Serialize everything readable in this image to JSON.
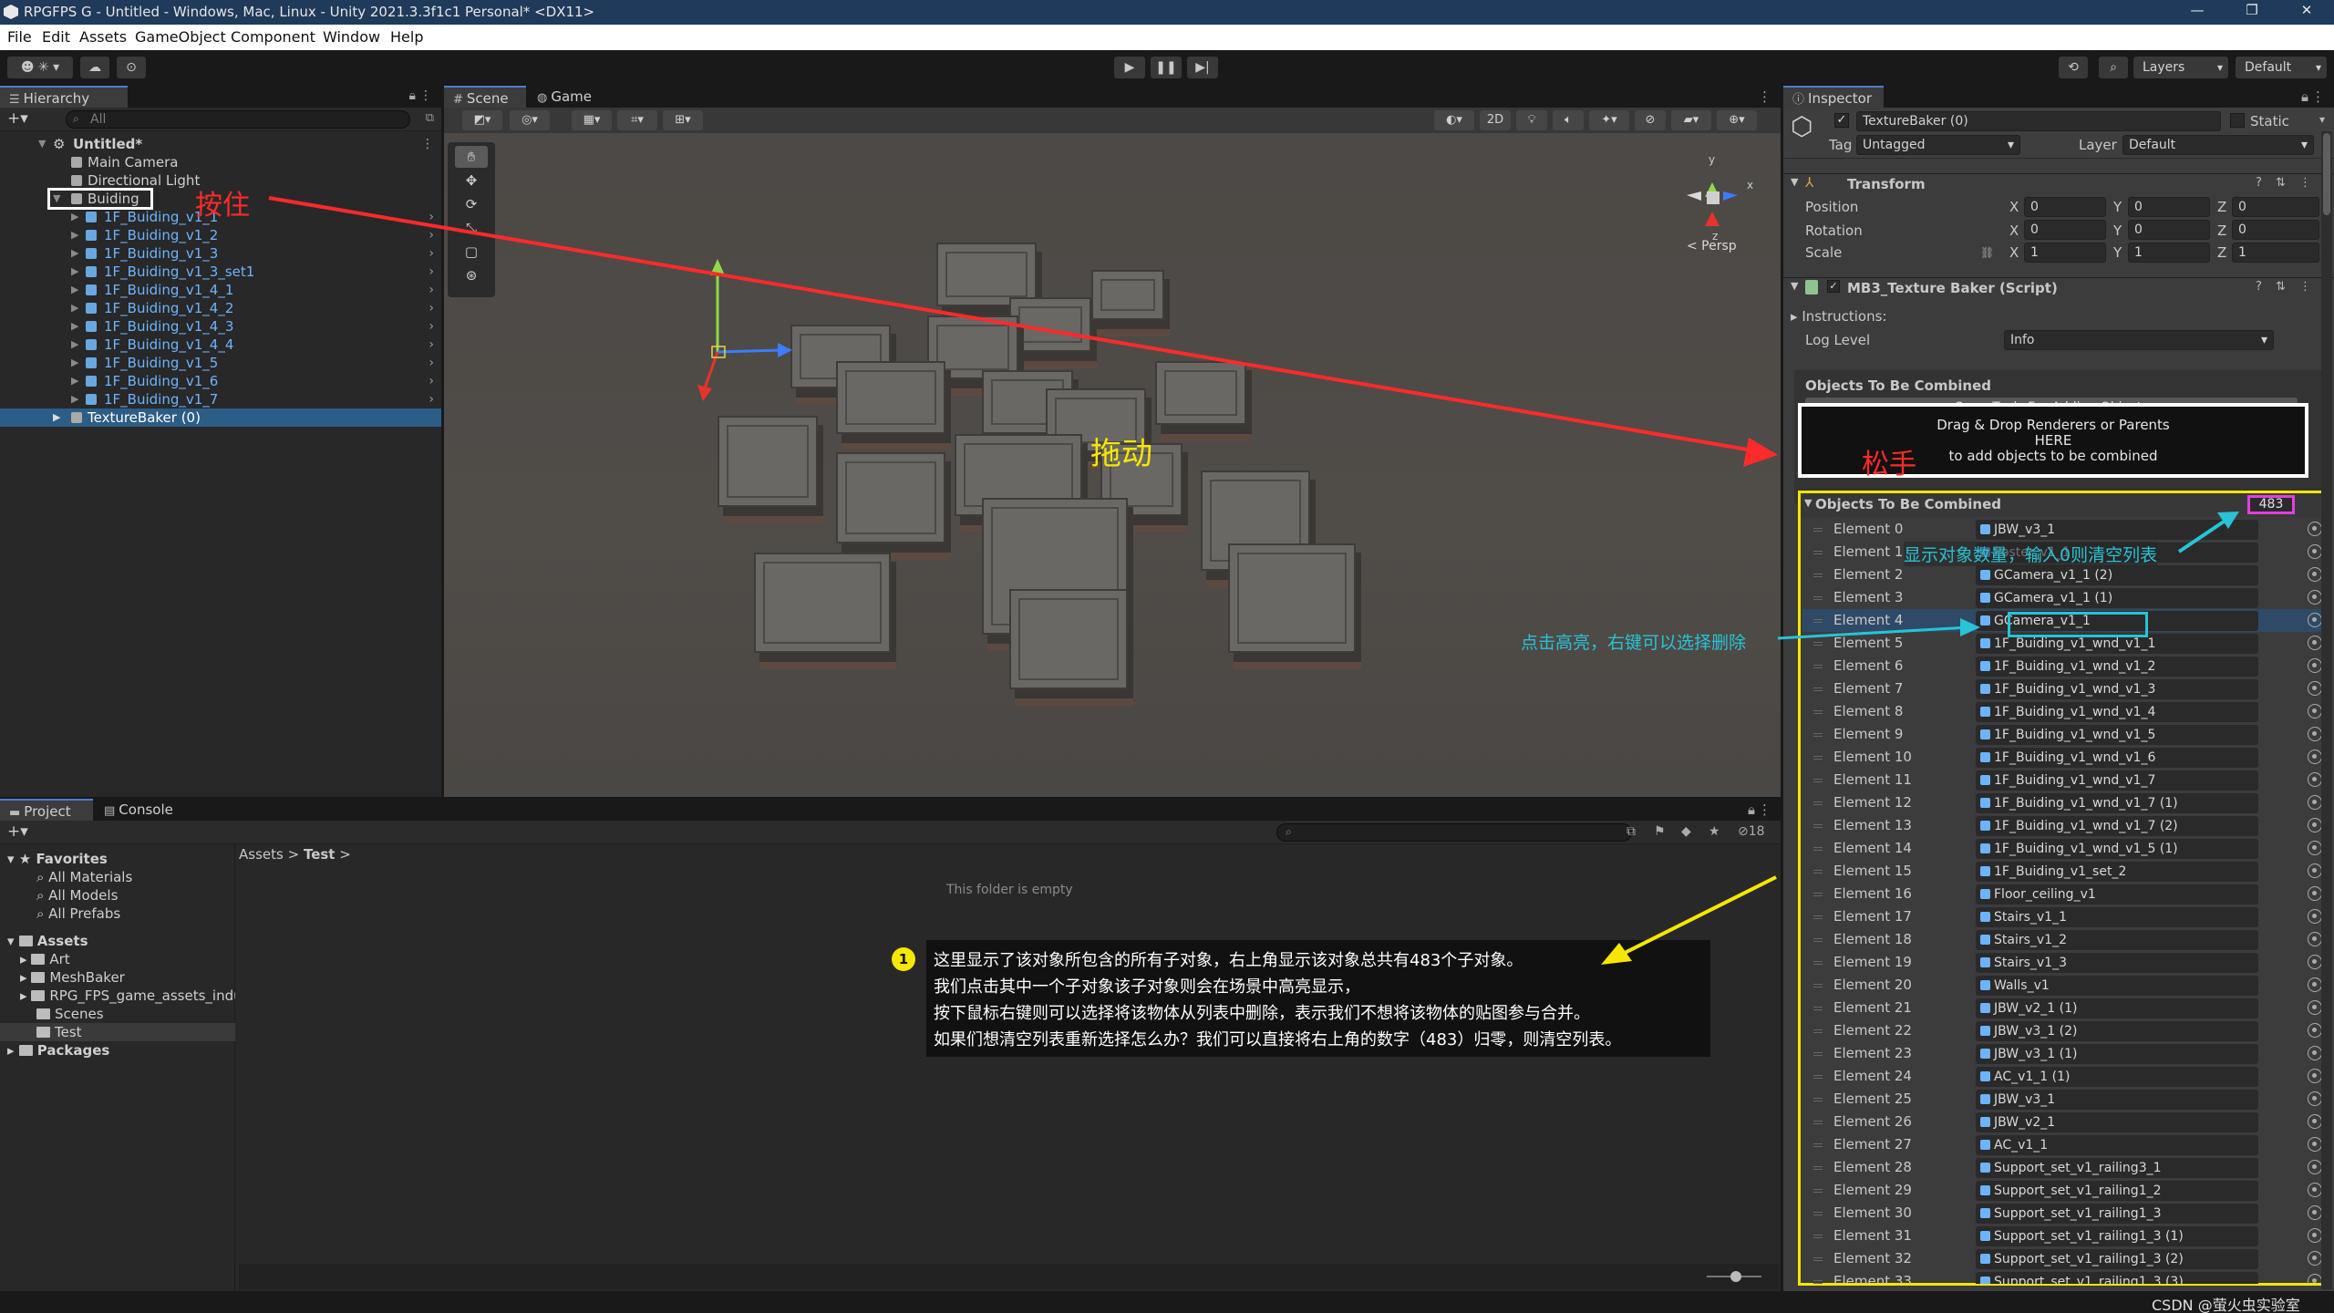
{
  "window": {
    "title": "RPGFPS G - Untitled - Windows, Mac, Linux - Unity 2021.3.3f1c1 Personal* <DX11>",
    "controls": [
      "—",
      "❐",
      "✕"
    ]
  },
  "menu": [
    "File",
    "Edit",
    "Assets",
    "GameObject",
    "Component",
    "Window",
    "Help"
  ],
  "toolbar": {
    "account": "☻",
    "layers": "Layers",
    "layout": "Default"
  },
  "hierarchy": {
    "tab": "Hierarchy",
    "search_placeholder": "All",
    "scene": "Untitled*",
    "items": [
      {
        "label": "Main Camera"
      },
      {
        "label": "Directional Light"
      },
      {
        "label": "Buiding"
      },
      {
        "label": "1F_Buiding_v1_1"
      },
      {
        "label": "1F_Buiding_v1_2"
      },
      {
        "label": "1F_Buiding_v1_3"
      },
      {
        "label": "1F_Buiding_v1_3_set1"
      },
      {
        "label": "1F_Buiding_v1_4_1"
      },
      {
        "label": "1F_Buiding_v1_4_2"
      },
      {
        "label": "1F_Buiding_v1_4_3"
      },
      {
        "label": "1F_Buiding_v1_4_4"
      },
      {
        "label": "1F_Buiding_v1_5"
      },
      {
        "label": "1F_Buiding_v1_6"
      },
      {
        "label": "1F_Buiding_v1_7"
      },
      {
        "label": "TextureBaker (0)"
      }
    ]
  },
  "scene": {
    "tabs": [
      "Scene",
      "Game"
    ],
    "view_2d": "2D",
    "persp": "< Persp",
    "gizmo_y": "y",
    "gizmo_x": "x",
    "gizmo_z": "z"
  },
  "project": {
    "tabs": [
      "Project",
      "Console"
    ],
    "favorites": "Favorites",
    "fav_items": [
      "All Materials",
      "All Models",
      "All Prefabs"
    ],
    "assets": "Assets",
    "asset_items": [
      "Art",
      "MeshBaker",
      "RPG_FPS_game_assets_indu",
      "Scenes",
      "Test"
    ],
    "packages": "Packages",
    "breadcrumb_root": "Assets",
    "breadcrumb_current": "Test",
    "empty_text": "This folder is empty",
    "hidden_count": "18"
  },
  "inspector": {
    "tab": "Inspector",
    "object_name": "TextureBaker (0)",
    "static_label": "Static",
    "tag_label": "Tag",
    "tag_value": "Untagged",
    "layer_label": "Layer",
    "layer_value": "Default",
    "transform": {
      "title": "Transform",
      "position_label": "Position",
      "rotation_label": "Rotation",
      "scale_label": "Scale",
      "position": [
        "0",
        "0",
        "0"
      ],
      "rotation": [
        "0",
        "0",
        "0"
      ],
      "scale": [
        "1",
        "1",
        "1"
      ],
      "axis": [
        "X",
        "Y",
        "Z"
      ]
    },
    "script": {
      "title": "MB3_Texture Baker (Script)",
      "instructions": "Instructions:",
      "log_level_label": "Log Level",
      "log_level_value": "Info",
      "section_title": "Objects To Be Combined",
      "open_tools": "Open Tools For Adding Objects",
      "drop_line1": "Drag & Drop Renderers or Parents",
      "drop_line2": "HERE",
      "drop_line3": "to add objects to be combined",
      "list_title": "Objects To Be Combined",
      "list_count": "483"
    },
    "elements": [
      {
        "label": "Element 0",
        "value": "JBW_v3_1"
      },
      {
        "label": "Element 1",
        "value": "Poster_v1_1"
      },
      {
        "label": "Element 2",
        "value": "GCamera_v1_1 (2)"
      },
      {
        "label": "Element 3",
        "value": "GCamera_v1_1 (1)"
      },
      {
        "label": "Element 4",
        "value": "GCamera_v1_1"
      },
      {
        "label": "Element 5",
        "value": "1F_Buiding_v1_wnd_v1_1"
      },
      {
        "label": "Element 6",
        "value": "1F_Buiding_v1_wnd_v1_2"
      },
      {
        "label": "Element 7",
        "value": "1F_Buiding_v1_wnd_v1_3"
      },
      {
        "label": "Element 8",
        "value": "1F_Buiding_v1_wnd_v1_4"
      },
      {
        "label": "Element 9",
        "value": "1F_Buiding_v1_wnd_v1_5"
      },
      {
        "label": "Element 10",
        "value": "1F_Buiding_v1_wnd_v1_6"
      },
      {
        "label": "Element 11",
        "value": "1F_Buiding_v1_wnd_v1_7"
      },
      {
        "label": "Element 12",
        "value": "1F_Buiding_v1_wnd_v1_7 (1)"
      },
      {
        "label": "Element 13",
        "value": "1F_Buiding_v1_wnd_v1_7 (2)"
      },
      {
        "label": "Element 14",
        "value": "1F_Buiding_v1_wnd_v1_5 (1)"
      },
      {
        "label": "Element 15",
        "value": "1F_Buiding_v1_set_2"
      },
      {
        "label": "Element 16",
        "value": "Floor_ceiling_v1"
      },
      {
        "label": "Element 17",
        "value": "Stairs_v1_1"
      },
      {
        "label": "Element 18",
        "value": "Stairs_v1_2"
      },
      {
        "label": "Element 19",
        "value": "Stairs_v1_3"
      },
      {
        "label": "Element 20",
        "value": "Walls_v1"
      },
      {
        "label": "Element 21",
        "value": "JBW_v2_1 (1)"
      },
      {
        "label": "Element 22",
        "value": "JBW_v3_1 (2)"
      },
      {
        "label": "Element 23",
        "value": "JBW_v3_1 (1)"
      },
      {
        "label": "Element 24",
        "value": "AC_v1_1 (1)"
      },
      {
        "label": "Element 25",
        "value": "JBW_v3_1"
      },
      {
        "label": "Element 26",
        "value": "JBW_v2_1"
      },
      {
        "label": "Element 27",
        "value": "AC_v1_1"
      },
      {
        "label": "Element 28",
        "value": "Support_set_v1_railing3_1"
      },
      {
        "label": "Element 29",
        "value": "Support_set_v1_railing1_2"
      },
      {
        "label": "Element 30",
        "value": "Support_set_v1_railing1_3"
      },
      {
        "label": "Element 31",
        "value": "Support_set_v1_railing1_3 (1)"
      },
      {
        "label": "Element 32",
        "value": "Support_set_v1_railing1_3 (2)"
      },
      {
        "label": "Element 33",
        "value": "Support_set_v1_railing1_3 (3)"
      }
    ]
  },
  "annotations": {
    "hold": "按住",
    "drag": "拖动",
    "release": "松手",
    "count_note": "显示对象数量，输入0则清空列表",
    "click_note": "点击高亮，右键可以选择删除",
    "note_number": "1",
    "note_lines": [
      "这里显示了该对象所包含的所有子对象，右上角显示该对象总共有483个子对象。",
      "我们点击其中一个子对象该子对象则会在场景中高亮显示，",
      "按下鼠标右键则可以选择将该物体从列表中删除，表示我们不想将该物体的贴图参与合并。",
      "如果们想清空列表重新选择怎么办？我们可以直接将右上角的数字（483）归零，则清空列表。"
    ],
    "watermark": "CSDN @萤火虫实验室",
    "colors": {
      "red": "#ff2a2a",
      "yellow": "#f7e600",
      "cyan": "#27c3d6",
      "magenta": "#e040e0"
    }
  }
}
